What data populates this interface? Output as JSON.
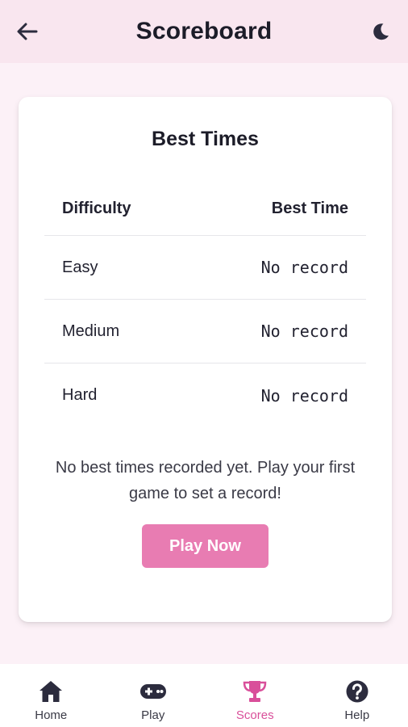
{
  "header": {
    "title": "Scoreboard",
    "back_icon": "arrow-left-icon",
    "theme_icon": "moon-icon"
  },
  "card": {
    "title": "Best Times",
    "columns": [
      "Difficulty",
      "Best Time"
    ],
    "rows": [
      {
        "difficulty": "Easy",
        "best_time": "No record"
      },
      {
        "difficulty": "Medium",
        "best_time": "No record"
      },
      {
        "difficulty": "Hard",
        "best_time": "No record"
      }
    ],
    "empty_message": "No best times recorded yet. Play your first game to set a record!",
    "play_button": "Play Now"
  },
  "nav": {
    "items": [
      {
        "label": "Home",
        "icon": "home-icon",
        "active": false
      },
      {
        "label": "Play",
        "icon": "gamepad-icon",
        "active": false
      },
      {
        "label": "Scores",
        "icon": "trophy-icon",
        "active": true
      },
      {
        "label": "Help",
        "icon": "question-circle-icon",
        "active": false
      }
    ]
  },
  "colors": {
    "accent": "#e87cb2",
    "active_nav": "#d94f9a",
    "header_bg": "#f9e6ef",
    "page_bg": "#fcf1f7",
    "icon_dark": "#2c2c3e"
  }
}
